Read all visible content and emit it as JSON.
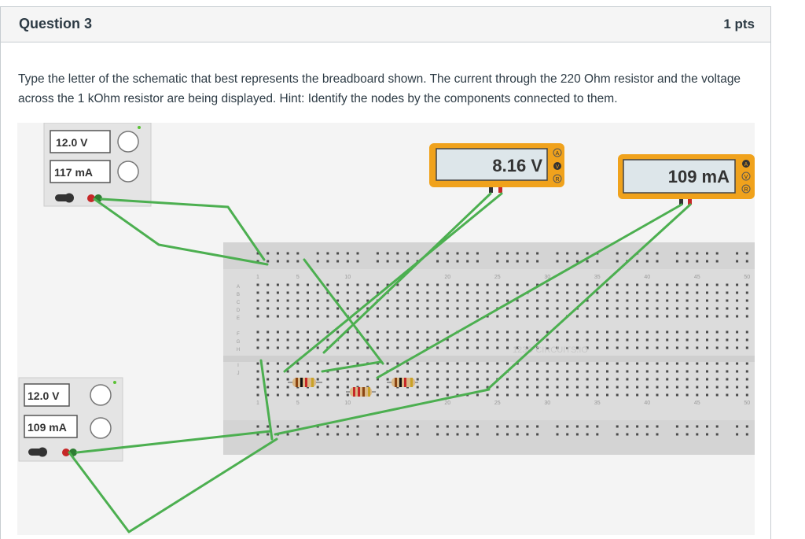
{
  "question": {
    "title": "Question 3",
    "points": "1 pts",
    "prompt": "Type the letter of the schematic that best represents the breadboard shown. The current through the 220 Ohm resistor and the voltage across the 1 kOhm resistor are being displayed. Hint: Identify the nodes by the components connected to them."
  },
  "circuit": {
    "power_supply_top": {
      "voltage": "12.0 V",
      "current": "117 mA"
    },
    "power_supply_bottom": {
      "voltage": "12.0 V",
      "current": "109 mA"
    },
    "voltmeter": {
      "reading": "8.16 V",
      "modes": [
        "A",
        "V",
        "R"
      ]
    },
    "ammeter": {
      "reading": "109 mA",
      "modes": [
        "A",
        "V",
        "R"
      ]
    },
    "breadboard": {
      "brand": "123D CIRCUITS.IO",
      "column_numbers_top": [
        "1",
        "5",
        "10",
        "20",
        "25",
        "30",
        "35",
        "40",
        "45",
        "50"
      ],
      "column_numbers_bottom": [
        "1",
        "5",
        "10",
        "20",
        "25",
        "30",
        "35",
        "40",
        "45",
        "50"
      ],
      "row_letters_top": [
        "A",
        "B",
        "C",
        "D",
        "E"
      ],
      "row_letters_bottom": [
        "F",
        "G",
        "H",
        "I",
        "J"
      ]
    },
    "colors": {
      "wire": "#4caf50",
      "meter_frame": "#f0a21c",
      "lcd": "#dde6ea"
    }
  }
}
